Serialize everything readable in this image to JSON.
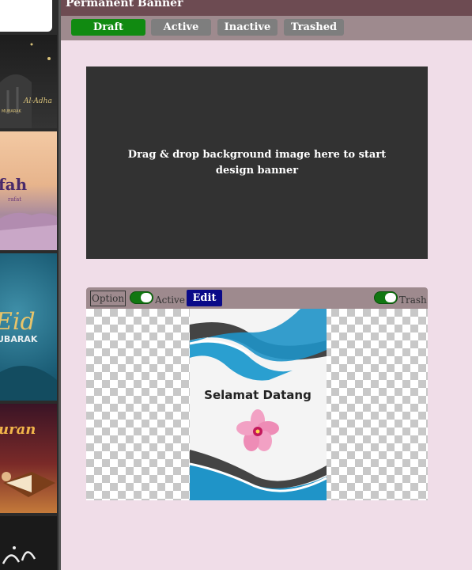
{
  "header": {
    "title": "Permanent Banner"
  },
  "tabs": [
    {
      "label": "Draft",
      "color": "#118a11"
    },
    {
      "label": "Active",
      "color": "#7e7e7e"
    },
    {
      "label": "Inactive",
      "color": "#7e7e7e"
    },
    {
      "label": "Trashed",
      "color": "#7e7e7e"
    }
  ],
  "dropzone": {
    "message": "Drag & drop background image here to start design banner"
  },
  "banner_card": {
    "option_label": "Option",
    "active_label": "Active",
    "edit_label": "Edit",
    "trash_label": "Trash",
    "active_toggle_on": true,
    "trash_toggle_on": true,
    "preview_text": "Selamat Datang"
  },
  "thumbnails": [
    {
      "text": ""
    },
    {
      "text": "Al-Adha MUBARAK"
    },
    {
      "text": "Arafah"
    },
    {
      "text": "Eid MUBARAK"
    },
    {
      "text": "Quran"
    },
    {
      "text": ""
    }
  ]
}
